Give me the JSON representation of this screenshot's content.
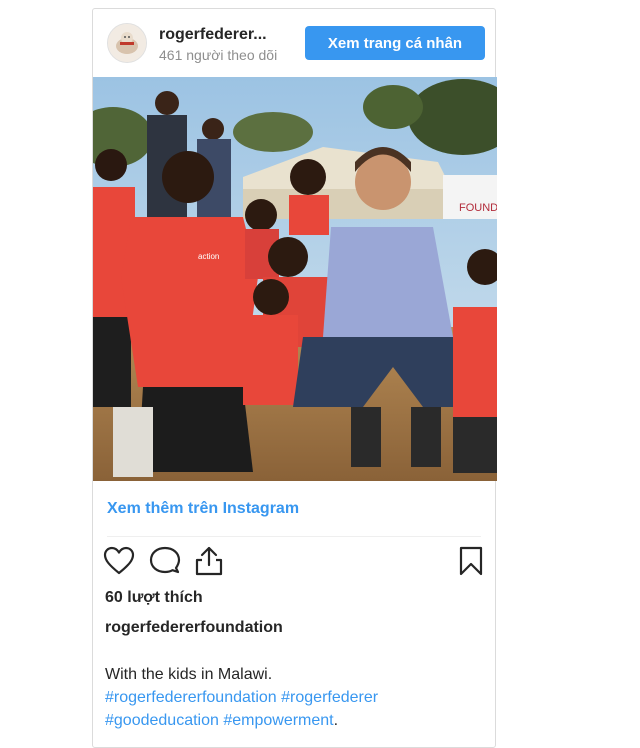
{
  "header": {
    "username": "rogerfederer...",
    "followers": "461 người theo dõi",
    "profile_button": "Xem trang cá nhân"
  },
  "post": {
    "view_more": "Xem thêm trên Instagram",
    "likes": "60 lượt thích",
    "poster": "rogerfedererfoundation",
    "caption_text": "With the kids in Malawi.",
    "hashtags": [
      "#rogerfedererfoundation",
      "#rogerfederer",
      "#goodeducation",
      "#empowerment"
    ],
    "caption_end": "."
  },
  "photo": {
    "banner_text": "FOUND",
    "shirt_text": "action"
  },
  "icons": {
    "like": "heart-icon",
    "comment": "comment-icon",
    "share": "share-icon",
    "save": "bookmark-icon"
  },
  "colors": {
    "link_blue": "#3897f0",
    "text": "#262626",
    "muted": "#8e8e8e",
    "shirt_red": "#e8473a"
  }
}
